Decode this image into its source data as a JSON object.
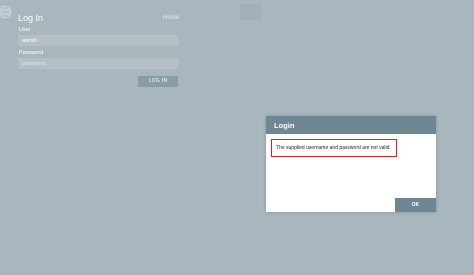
{
  "login_page": {
    "title": "Log In",
    "home_link": "Home",
    "user_label": "User",
    "user_value": "admin",
    "password_label": "Password",
    "password_placeholder": "password",
    "login_button": "LOG IN"
  },
  "dialog": {
    "title": "Login",
    "message": "The supplied username and password are not valid.",
    "ok_button": "OK"
  },
  "colors": {
    "overlay_background": "#a8b6bd",
    "dialog_header": "#6f8793",
    "error_border": "#e02020"
  }
}
